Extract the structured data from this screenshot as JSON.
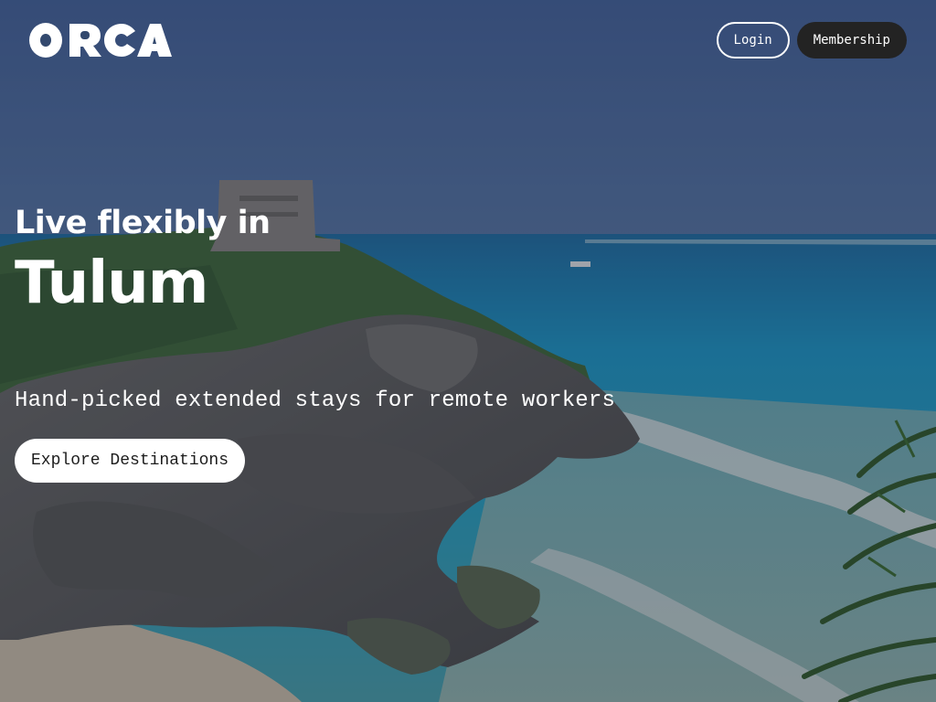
{
  "brand": {
    "name": "ORCA",
    "logo_color": "#ffffff"
  },
  "header": {
    "login_label": "Login",
    "membership_label": "Membership"
  },
  "hero": {
    "lead": "Live flexibly in",
    "city": "Tulum",
    "tagline": "Hand-picked extended stays for remote workers",
    "cta_label": "Explore Destinations"
  },
  "colors": {
    "overlay": "#1c2638",
    "sky": "#4a6290",
    "sea": "#1aa0d4",
    "membership_button": "#232323",
    "cta_button": "#ffffff"
  }
}
